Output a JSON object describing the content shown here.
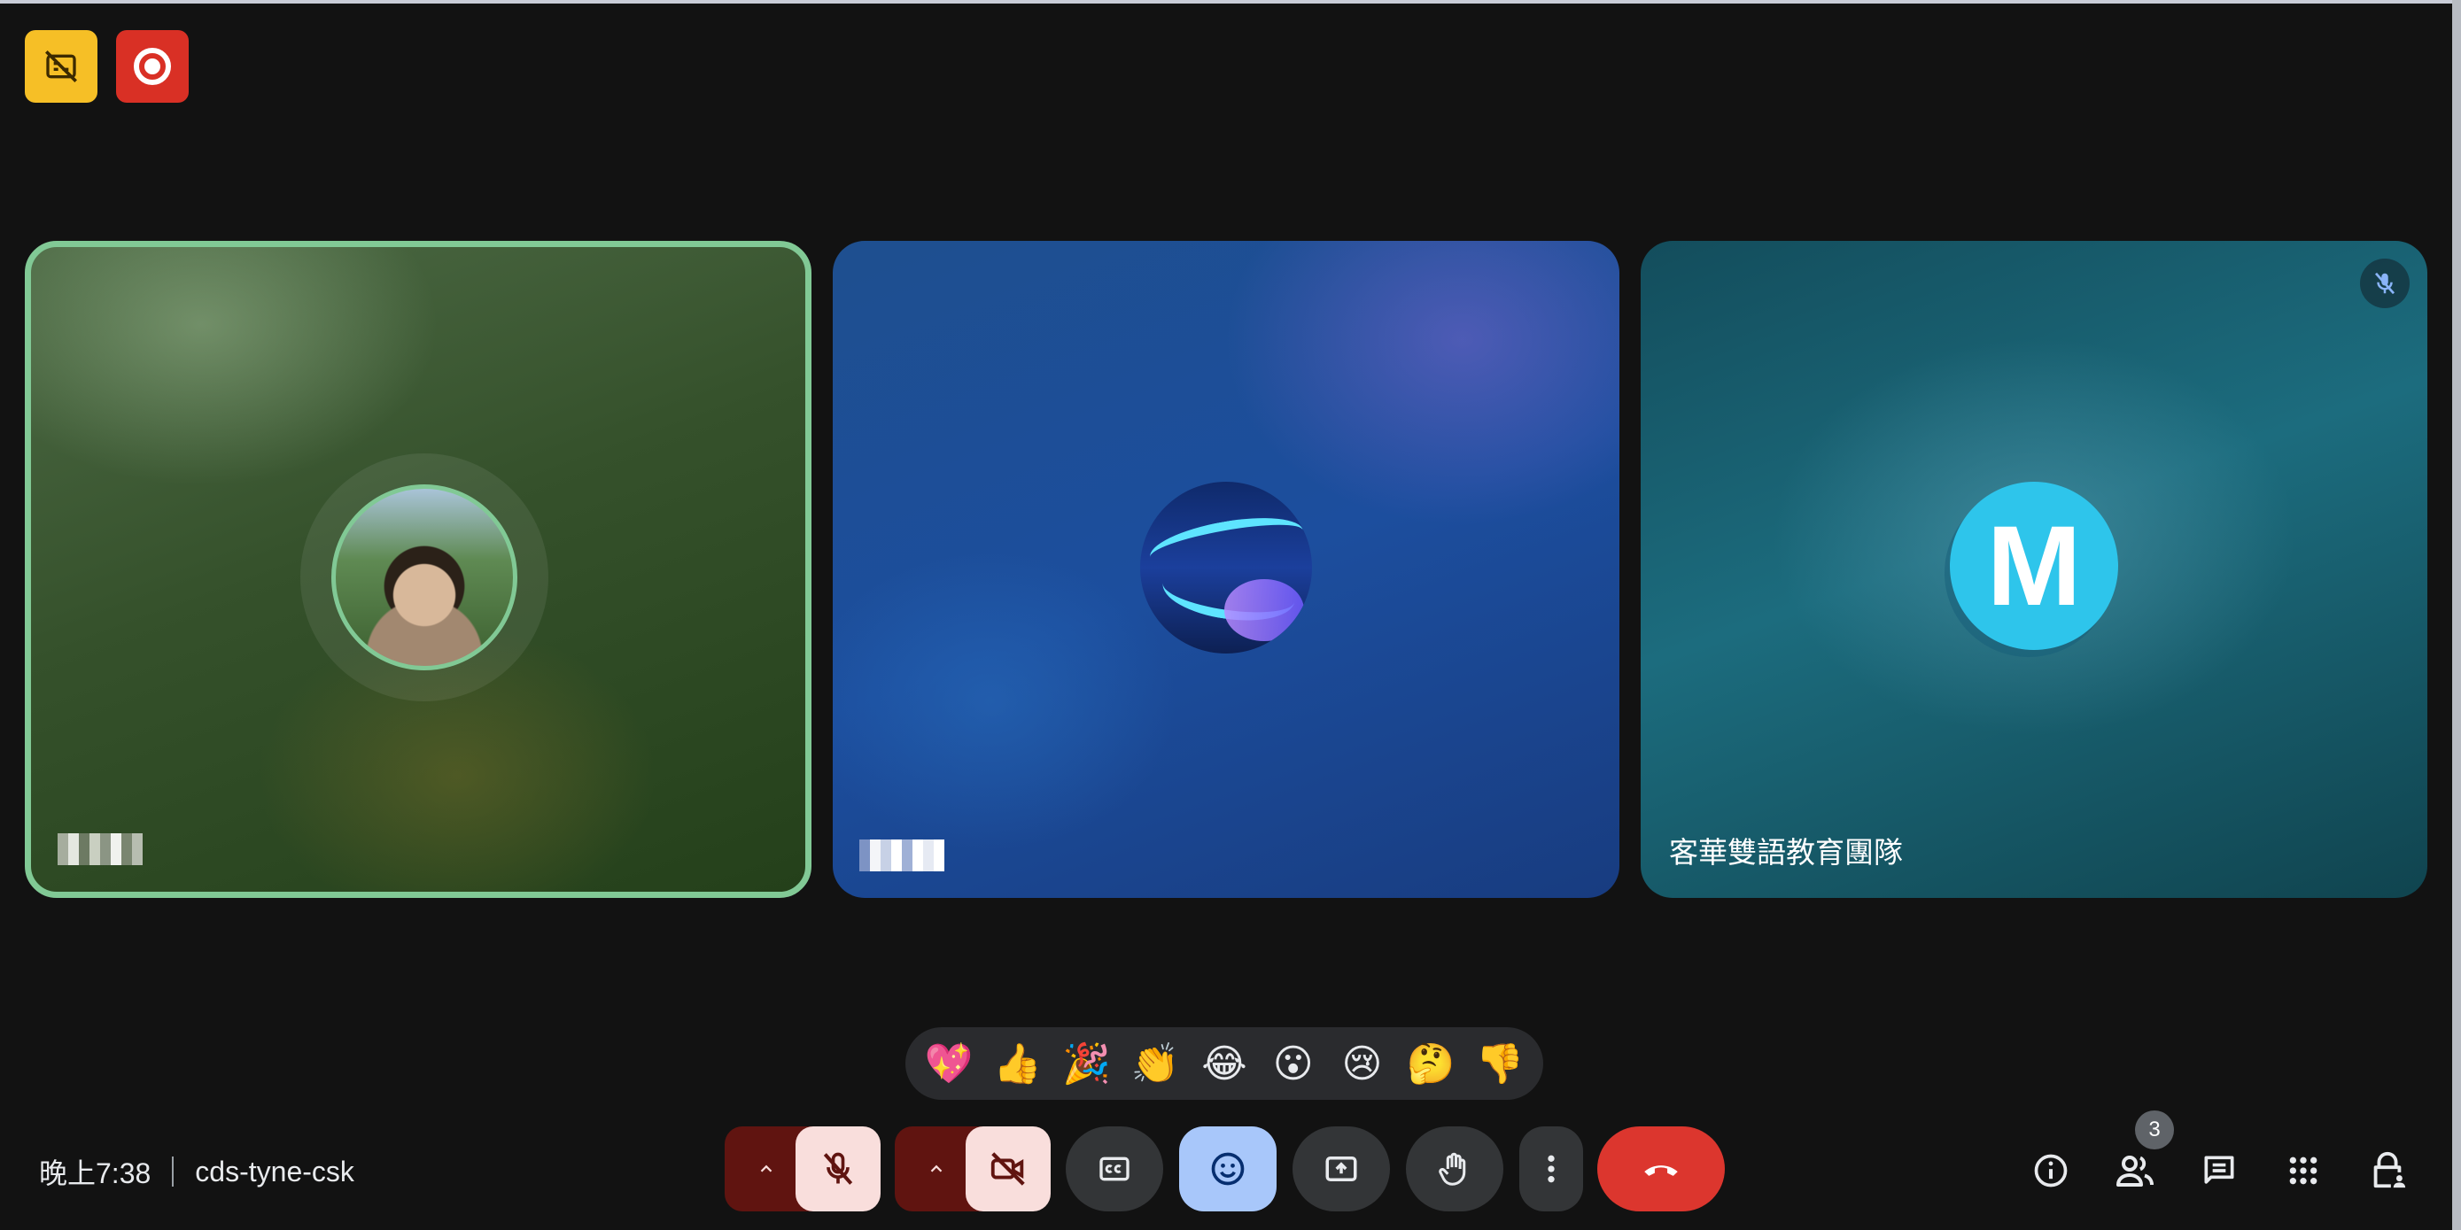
{
  "indicators": {
    "captions_off": "closed-captions-off-icon",
    "recording": "recording-icon"
  },
  "participants": [
    {
      "name_visible": false,
      "avatar": "photo",
      "active_speaker": true
    },
    {
      "name_visible": false,
      "avatar": "artwork"
    },
    {
      "name": "客華雙語教育團隊",
      "avatar_letter": "M",
      "muted": true
    }
  ],
  "reactions": [
    "💖",
    "👍",
    "🎉",
    "👏",
    "😂",
    "😮",
    "😢",
    "🤔",
    "👎"
  ],
  "meeting": {
    "time": "晚上7:38",
    "code": "cds-tyne-csk"
  },
  "controls": {
    "mic": "mic-off-icon",
    "camera": "camera-off-icon",
    "captions": "captions-icon",
    "emoji": "emoji-icon",
    "present": "present-icon",
    "raise_hand": "hand-icon",
    "more": "more-vert-icon",
    "leave": "call-end-icon"
  },
  "right_controls": {
    "people_count": "3"
  },
  "colors": {
    "background": "#121212",
    "active_speaker": "#81c995",
    "leave": "#dc362e",
    "muted_bg": "#f9dedc",
    "emoji_active": "#a8c7fa",
    "letter_avatar": "#2ec5eb"
  }
}
